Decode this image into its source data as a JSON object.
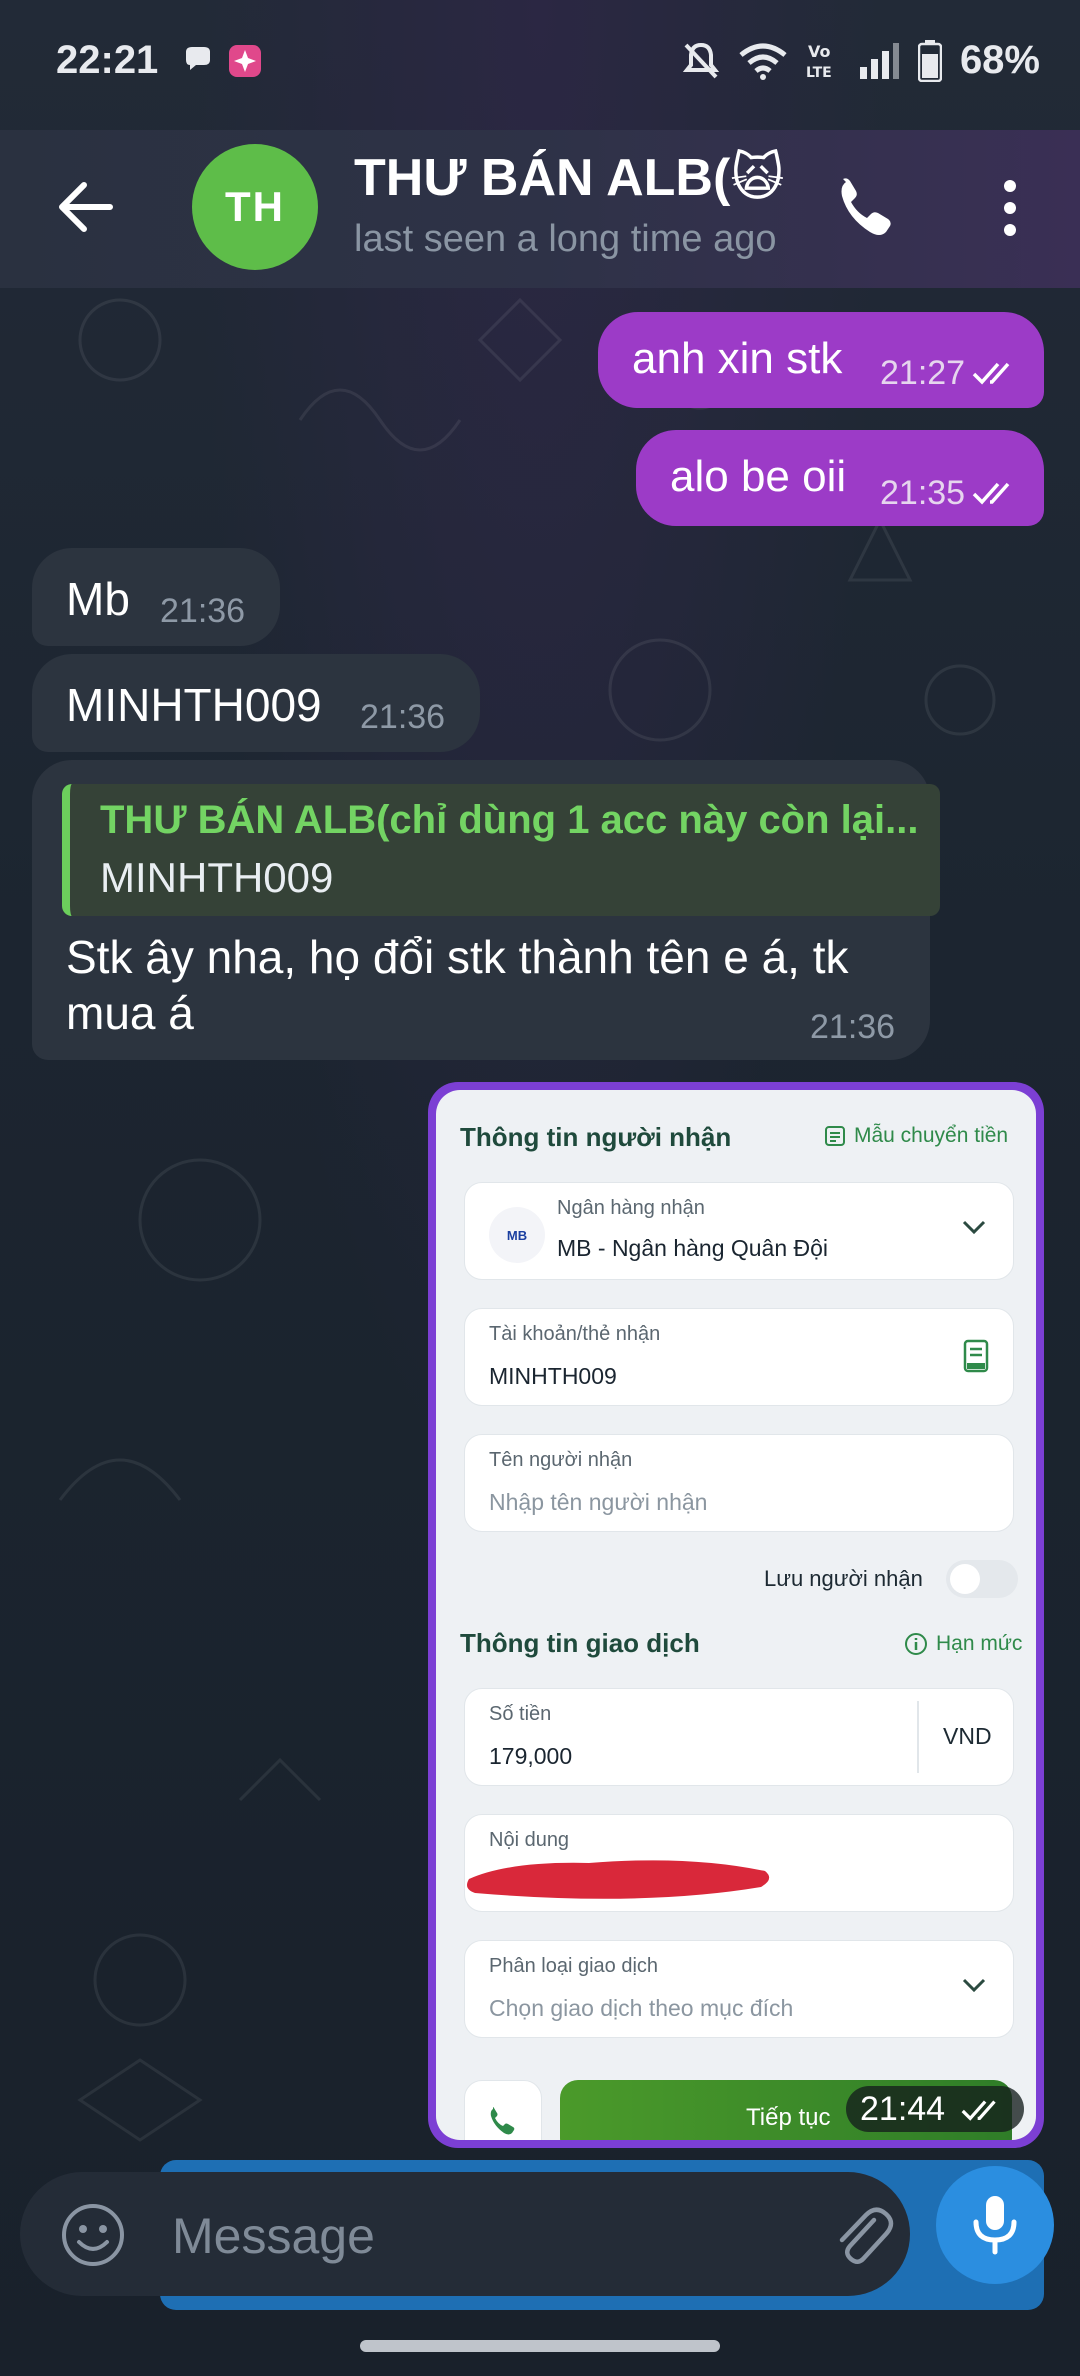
{
  "status_bar": {
    "time": "22:21",
    "battery": "68%",
    "icons": [
      "chat-bubble-icon",
      "app-launcher-icon",
      "mute-icon",
      "wifi-icon",
      "volte-icon",
      "signal-icon",
      "battery-icon"
    ]
  },
  "header": {
    "avatar_initials": "TH",
    "avatar_color": "#5ebd49",
    "title": "THƯ BÁN ALB(",
    "title_emoji": "🙀",
    "subtitle": "last seen a long time ago"
  },
  "messages": [
    {
      "dir": "out",
      "text": "anh xin stk",
      "time": "21:27"
    },
    {
      "dir": "out",
      "text": "alo be oii",
      "time": "21:35"
    },
    {
      "dir": "in",
      "text": "Mb",
      "time": "21:36"
    },
    {
      "dir": "in",
      "text": "MINHTH009",
      "time": "21:36"
    },
    {
      "dir": "in",
      "reply_name": "THƯ BÁN ALB(chỉ dùng 1 acc này còn lại...",
      "reply_text": "MINHTH009",
      "text_line1": "Stk ây nha, họ đổi stk thành tên e á, tk",
      "text_line2": "mua á",
      "time": "21:36"
    }
  ],
  "image_message": {
    "time": "21:44",
    "section1_title": "Thông tin người nhận",
    "template_link": "Mẫu chuyển tiền",
    "bank_label": "Ngân hàng nhận",
    "bank_logo": "MB",
    "bank_value": "MB - Ngân hàng Quân Đội",
    "account_label": "Tài khoản/thẻ nhận",
    "account_value": "MINHTH009",
    "recipient_label": "Tên người nhận",
    "recipient_placeholder": "Nhập tên người nhận",
    "save_label": "Lưu người nhận",
    "section2_title": "Thông tin giao dịch",
    "limit_link": "Hạn mức",
    "amount_label": "Số tiền",
    "amount_value": "179,000",
    "currency": "VND",
    "content_label": "Nội dung",
    "category_label": "Phân loại giao dịch",
    "category_placeholder": "Chọn giao dịch theo mục đích",
    "continue_label": "Tiếp tục"
  },
  "input": {
    "placeholder": "Message"
  },
  "colors": {
    "outgoing_bubble": "#9c3bc7",
    "incoming_bubble": "#2c343f",
    "reply_accent": "#6ccf5c",
    "mic_button": "#2b8ee0",
    "redaction": "#d9283a"
  }
}
